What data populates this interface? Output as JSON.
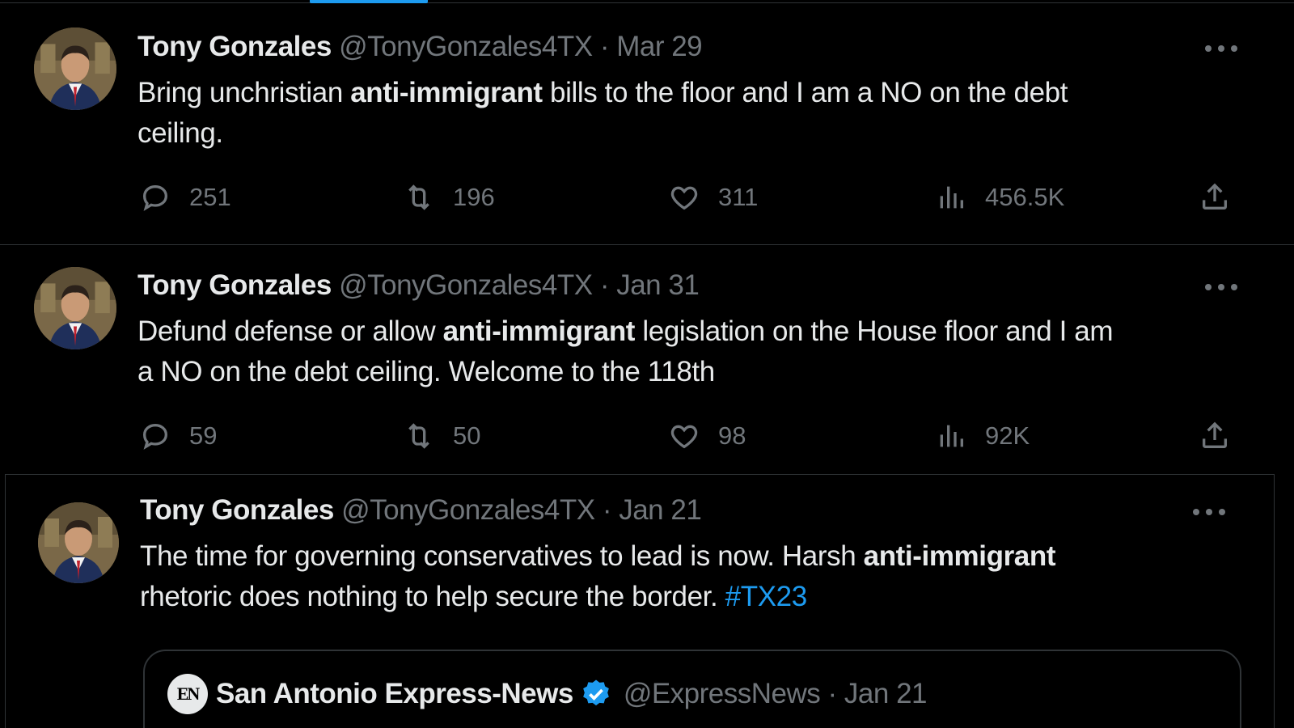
{
  "colors": {
    "background": "#000000",
    "text": "#e7e9ea",
    "muted": "#71767b",
    "accent": "#1d9bf0",
    "border": "#2f3336"
  },
  "tweets": [
    {
      "author": {
        "name": "Tony Gonzales",
        "handle": "@TonyGonzales4TX"
      },
      "separator": "·",
      "date": "Mar 29",
      "text_parts": [
        "Bring unchristian ",
        "anti-immigrant",
        " bills to the floor and I am a NO on the debt",
        "ceiling."
      ],
      "stats": {
        "replies": "251",
        "retweets": "196",
        "likes": "311",
        "views": "456.5K"
      }
    },
    {
      "author": {
        "name": "Tony Gonzales",
        "handle": "@TonyGonzales4TX"
      },
      "separator": "·",
      "date": "Jan 31",
      "text_parts": [
        "Defund defense or allow ",
        "anti-immigrant",
        " legislation on the House floor and I am",
        "a NO on the debt ceiling. Welcome to the 118th"
      ],
      "stats": {
        "replies": "59",
        "retweets": "50",
        "likes": "98",
        "views": "92K"
      }
    },
    {
      "author": {
        "name": "Tony Gonzales",
        "handle": "@TonyGonzales4TX"
      },
      "separator": "·",
      "date": "Jan 21",
      "text_parts": [
        "The time for governing conservatives to lead is now. Harsh ",
        "anti-immigrant",
        "rhetoric does nothing to help secure the border. ",
        "#TX23"
      ],
      "quote": {
        "logo_text": "EN",
        "name": "San Antonio Express-News",
        "handle": "@ExpressNews",
        "separator": "·",
        "date": "Jan 21"
      }
    }
  ],
  "icons": [
    "reply-icon",
    "retweet-icon",
    "like-icon",
    "views-icon",
    "share-icon",
    "more-icon",
    "verified-badge-icon",
    "avatar"
  ]
}
